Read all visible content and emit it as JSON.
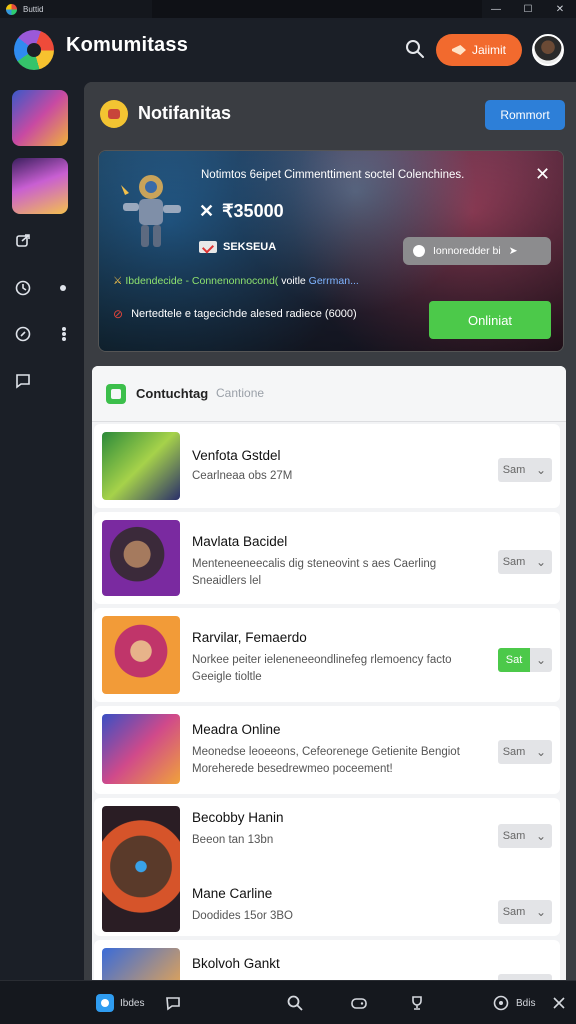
{
  "titlebar": {
    "title": "Buttid",
    "minimize": "—",
    "maximize": "☐",
    "close": "✕"
  },
  "header": {
    "brand": "Komumitass",
    "button_label": "Jaiimit"
  },
  "main": {
    "title": "Notifanitas",
    "top_button": "Rommort",
    "banner": {
      "description": "Notimtos 6eipet Cimmenttiment soctel Colenchines.",
      "price": "₹35000",
      "tag": "SEKSEUA",
      "pill_label": "Ionnoredder bi",
      "line1_a": "Ibdendecide",
      "line1_b": "- Connenonnocond(",
      "line1_c": "voitle",
      "line1_d": "Gerrman...",
      "line2": "Nertedtele e tagecichde alesed radiece (6000)",
      "action": "Onliniat"
    },
    "list": {
      "title": "Contuchtag",
      "subtitle": "Cantione",
      "items": [
        {
          "title": "Venfota Gstdel",
          "subtitle": "Cearlneaa obs 27M",
          "button": "Sam",
          "active": false
        },
        {
          "title": "Mavlata Bacidel",
          "subtitle": "Menteneeneecalis dig steneovint s aes Caerling Sneaidlers lel",
          "button": "Sam",
          "active": false
        },
        {
          "title": "Rarvilar, Femaerdo",
          "subtitle": "Norkee peiter ieleneneeondlinefeg rlemoency facto Geeigle tioltle",
          "button": "Sat",
          "active": true
        },
        {
          "title": "Meadra Online",
          "subtitle": "Meonedse leoeeons, Cefeorenege Getienite Bengiot Moreherede besedrewmeo poceement!",
          "button": "Sam",
          "active": false
        },
        {
          "title": "Becobby Hanin",
          "subtitle": "Beeon tan 13bn",
          "button": "Sam",
          "active": false
        },
        {
          "title": "Mane Carline",
          "subtitle": "Doodides 15or 3BO",
          "button": "Sam",
          "active": false
        },
        {
          "title": "Bkolvoh Gankt",
          "subtitle": "",
          "button": "",
          "active": false
        }
      ]
    }
  },
  "bottombar": {
    "home_label": "Ibdes",
    "right_label": "Bdis"
  }
}
